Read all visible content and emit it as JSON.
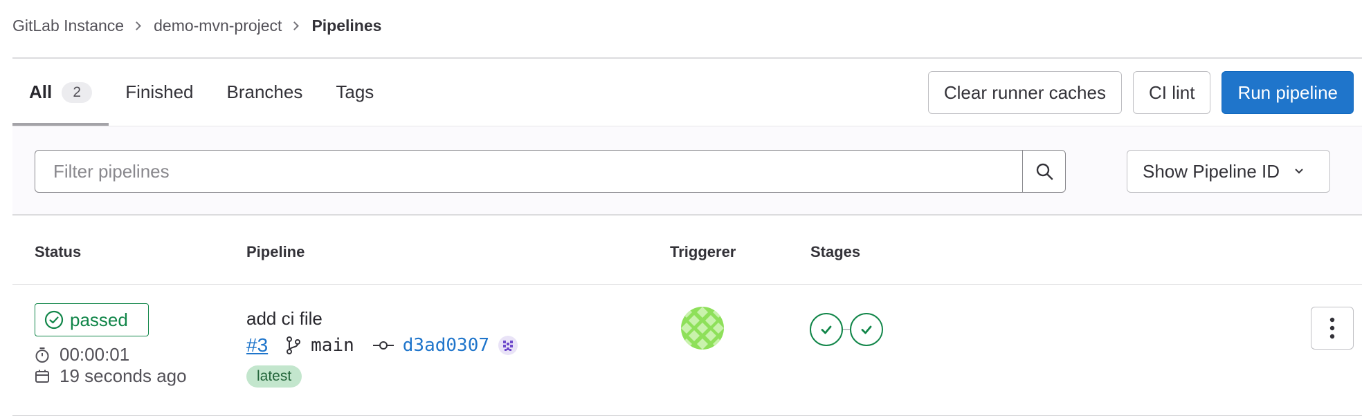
{
  "breadcrumb": {
    "items": [
      "GitLab Instance",
      "demo-mvn-project"
    ],
    "current": "Pipelines"
  },
  "tabs": [
    {
      "label": "All",
      "count": "2",
      "active": true
    },
    {
      "label": "Finished"
    },
    {
      "label": "Branches"
    },
    {
      "label": "Tags"
    }
  ],
  "actions": {
    "clear_caches": "Clear runner caches",
    "ci_lint": "CI lint",
    "run_pipeline": "Run pipeline"
  },
  "filter": {
    "placeholder": "Filter pipelines",
    "show_id_label": "Show Pipeline ID"
  },
  "table": {
    "headers": [
      "Status",
      "Pipeline",
      "Triggerer",
      "Stages"
    ]
  },
  "pipelines": [
    {
      "status": "passed",
      "duration": "00:00:01",
      "finished": "19 seconds ago",
      "commit_title": "add ci file",
      "id": "#3",
      "ref": "main",
      "sha": "d3ad0307",
      "badge": "latest",
      "stages": [
        "passed",
        "passed"
      ]
    }
  ],
  "colors": {
    "primary": "#1f75cb",
    "success": "#108548",
    "latest_bg": "#c3e6cd",
    "latest_fg": "#24663b"
  }
}
